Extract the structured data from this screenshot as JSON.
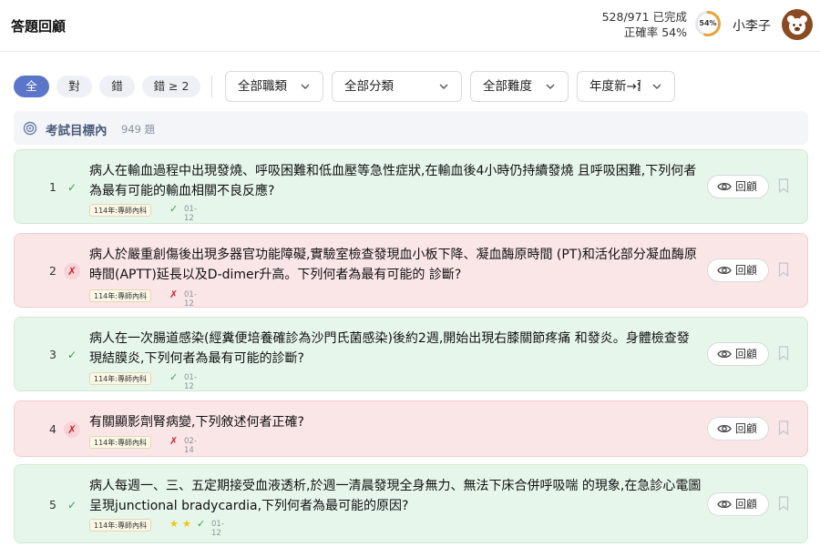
{
  "header": {
    "title": "答題回顧",
    "progress_text": "528/971 已完成",
    "accuracy_text": "正確率 54%",
    "ring_label": "54%",
    "ring_fraction": 0.54,
    "username": "小李子",
    "avatar_icon": "bear-avatar-icon"
  },
  "filters": {
    "pills": [
      {
        "label": "全",
        "active": true
      },
      {
        "label": "對",
        "active": false
      },
      {
        "label": "錯",
        "active": false
      },
      {
        "label": "錯 ≥ 2",
        "active": false
      }
    ],
    "selects": [
      {
        "value": "全部職類"
      },
      {
        "value": "全部分類"
      },
      {
        "value": "全部難度"
      },
      {
        "value": "年度新→舊"
      }
    ]
  },
  "section": {
    "title": "考試目標內",
    "count": "949 題",
    "icon": "target-icon"
  },
  "review_label": "回顧",
  "questions": [
    {
      "num": "1",
      "status": "correct",
      "text": "病人在輸血過程中出現發燒、呼吸困難和低血壓等急性症狀,在輸血後4小時仍持續發燒 且呼吸困難,下列何者為最有可能的輸血相關不良反應?",
      "tag": "114年:專師內科",
      "date": "01-12",
      "stars": 0
    },
    {
      "num": "2",
      "status": "wrong",
      "text": "病人於嚴重創傷後出現多器官功能障礙,實驗室檢查發現血小板下降、凝血酶原時間 (PT)和活化部分凝血酶原時間(APTT)延長以及D-dimer升高。下列何者為最有可能的 診斷?",
      "tag": "114年:專師內科",
      "date": "01-12",
      "stars": 0
    },
    {
      "num": "3",
      "status": "correct",
      "text": "病人在一次腸道感染(經糞便培養確診為沙門氏菌感染)後約2週,開始出現右膝關節疼痛 和發炎。身體檢查發現結膜炎,下列何者為最有可能的診斷?",
      "tag": "114年:專師內科",
      "date": "01-12",
      "stars": 0
    },
    {
      "num": "4",
      "status": "wrong",
      "text": "有關顯影劑腎病變,下列敘述何者正確?",
      "tag": "114年:專師內科",
      "date": "02-14",
      "stars": 0
    },
    {
      "num": "5",
      "status": "correct",
      "text": "病人每週一、三、五定期接受血液透析,於週一清晨發現全身無力、無法下床合併呼吸喘 的現象,在急診心電圖呈現junctional bradycardia,下列何者為最可能的原因?",
      "tag": "114年:專師內科",
      "date": "01-12",
      "stars": 2
    }
  ]
}
